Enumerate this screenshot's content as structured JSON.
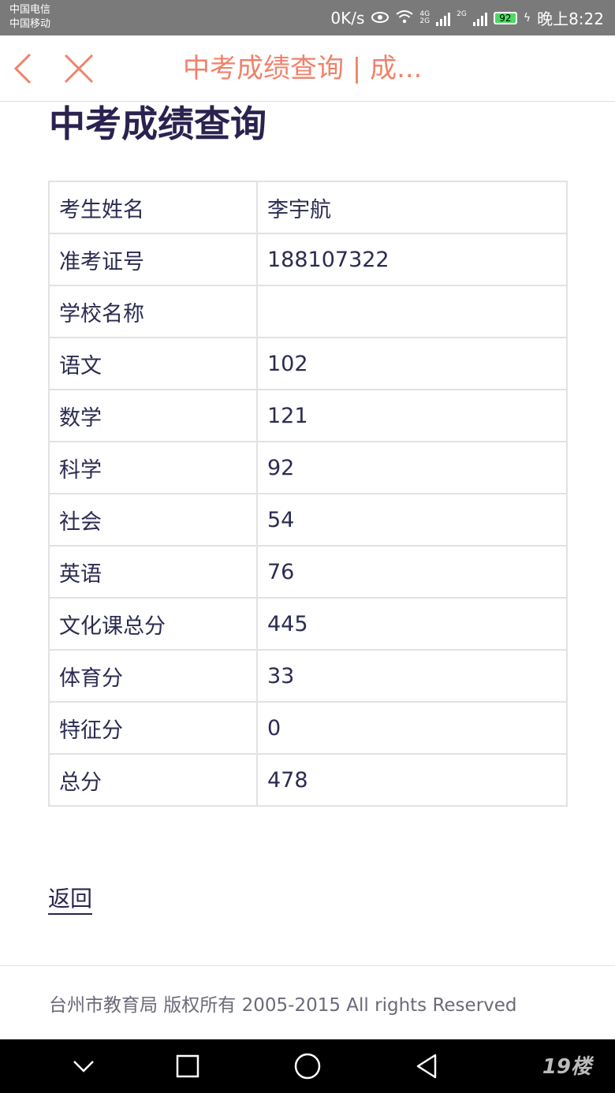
{
  "status_bar": {
    "carrier_1": "中国电信",
    "carrier_2": "中国移动",
    "net_speed": "0K/s",
    "net_4g_top": "4G",
    "net_4g_bottom": "2G",
    "net_2g": "2G",
    "battery": "92",
    "time": "晚上8:22"
  },
  "navbar": {
    "title": "中考成绩查询 | 成..."
  },
  "page": {
    "heading": "中考成绩查询",
    "back_link": "返回",
    "footer": "台州市教育局 版权所有 2005-2015 All rights Reserved"
  },
  "rows": [
    {
      "label": "考生姓名",
      "value": "李宇航"
    },
    {
      "label": "准考证号",
      "value": "188107322"
    },
    {
      "label": "学校名称",
      "value": ""
    },
    {
      "label": "语文",
      "value": "102"
    },
    {
      "label": "数学",
      "value": "121"
    },
    {
      "label": "科学",
      "value": "92"
    },
    {
      "label": "社会",
      "value": "54"
    },
    {
      "label": "英语",
      "value": "76"
    },
    {
      "label": "文化课总分",
      "value": "445"
    },
    {
      "label": "体育分",
      "value": "33"
    },
    {
      "label": "特征分",
      "value": "0"
    },
    {
      "label": "总分",
      "value": "478"
    }
  ],
  "watermark": "19楼"
}
